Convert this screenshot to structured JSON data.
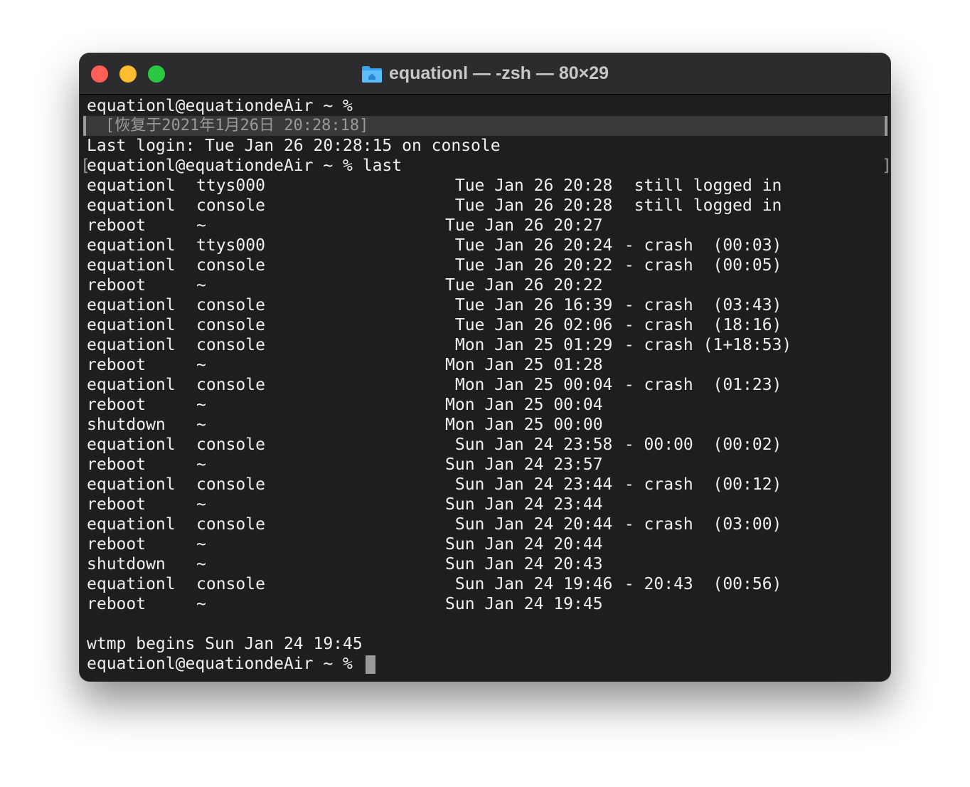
{
  "window": {
    "title": "equationl — -zsh — 80×29",
    "traffic_lights": {
      "close": "#ff5f57",
      "minimize": "#febc2e",
      "zoom": "#28c840"
    },
    "folder_icon": "home-folder-icon"
  },
  "terminal": {
    "prompt_line_1": "equationl@equationdeAir ~ %",
    "restore_marker": "[恢复于2021年1月26日 20:28:18]",
    "last_login": "Last login: Tue Jan 26 20:28:15 on console",
    "command_line": "equationl@equationdeAir ~ % last",
    "bracket_left": "[",
    "bracket_right": "]",
    "rows": [
      {
        "user": "equationl",
        "tty": "ttys000",
        "date": " Tue Jan 26 20:28",
        "end": "  still logged in"
      },
      {
        "user": "equationl",
        "tty": "console",
        "date": " Tue Jan 26 20:28",
        "end": "  still logged in"
      },
      {
        "user": "reboot",
        "tty": "~",
        "date": "Tue Jan 26 20:27",
        "end": ""
      },
      {
        "user": "equationl",
        "tty": "ttys000",
        "date": " Tue Jan 26 20:24",
        "end": " - crash  (00:03)"
      },
      {
        "user": "equationl",
        "tty": "console",
        "date": " Tue Jan 26 20:22",
        "end": " - crash  (00:05)"
      },
      {
        "user": "reboot",
        "tty": "~",
        "date": "Tue Jan 26 20:22",
        "end": ""
      },
      {
        "user": "equationl",
        "tty": "console",
        "date": " Tue Jan 26 16:39",
        "end": " - crash  (03:43)"
      },
      {
        "user": "equationl",
        "tty": "console",
        "date": " Tue Jan 26 02:06",
        "end": " - crash  (18:16)"
      },
      {
        "user": "equationl",
        "tty": "console",
        "date": " Mon Jan 25 01:29",
        "end": " - crash (1+18:53)"
      },
      {
        "user": "reboot",
        "tty": "~",
        "date": "Mon Jan 25 01:28",
        "end": ""
      },
      {
        "user": "equationl",
        "tty": "console",
        "date": " Mon Jan 25 00:04",
        "end": " - crash  (01:23)"
      },
      {
        "user": "reboot",
        "tty": "~",
        "date": "Mon Jan 25 00:04",
        "end": ""
      },
      {
        "user": "shutdown",
        "tty": "~",
        "date": "Mon Jan 25 00:00",
        "end": ""
      },
      {
        "user": "equationl",
        "tty": "console",
        "date": " Sun Jan 24 23:58",
        "end": " - 00:00  (00:02)"
      },
      {
        "user": "reboot",
        "tty": "~",
        "date": "Sun Jan 24 23:57",
        "end": ""
      },
      {
        "user": "equationl",
        "tty": "console",
        "date": " Sun Jan 24 23:44",
        "end": " - crash  (00:12)"
      },
      {
        "user": "reboot",
        "tty": "~",
        "date": "Sun Jan 24 23:44",
        "end": ""
      },
      {
        "user": "equationl",
        "tty": "console",
        "date": " Sun Jan 24 20:44",
        "end": " - crash  (03:00)"
      },
      {
        "user": "reboot",
        "tty": "~",
        "date": "Sun Jan 24 20:44",
        "end": ""
      },
      {
        "user": "shutdown",
        "tty": "~",
        "date": "Sun Jan 24 20:43",
        "end": ""
      },
      {
        "user": "equationl",
        "tty": "console",
        "date": " Sun Jan 24 19:46",
        "end": " - 20:43  (00:56)"
      },
      {
        "user": "reboot",
        "tty": "~",
        "date": "Sun Jan 24 19:45",
        "end": ""
      }
    ],
    "wtmp_line": "wtmp begins Sun Jan 24 19:45",
    "final_prompt": "equationl@equationdeAir ~ %"
  }
}
